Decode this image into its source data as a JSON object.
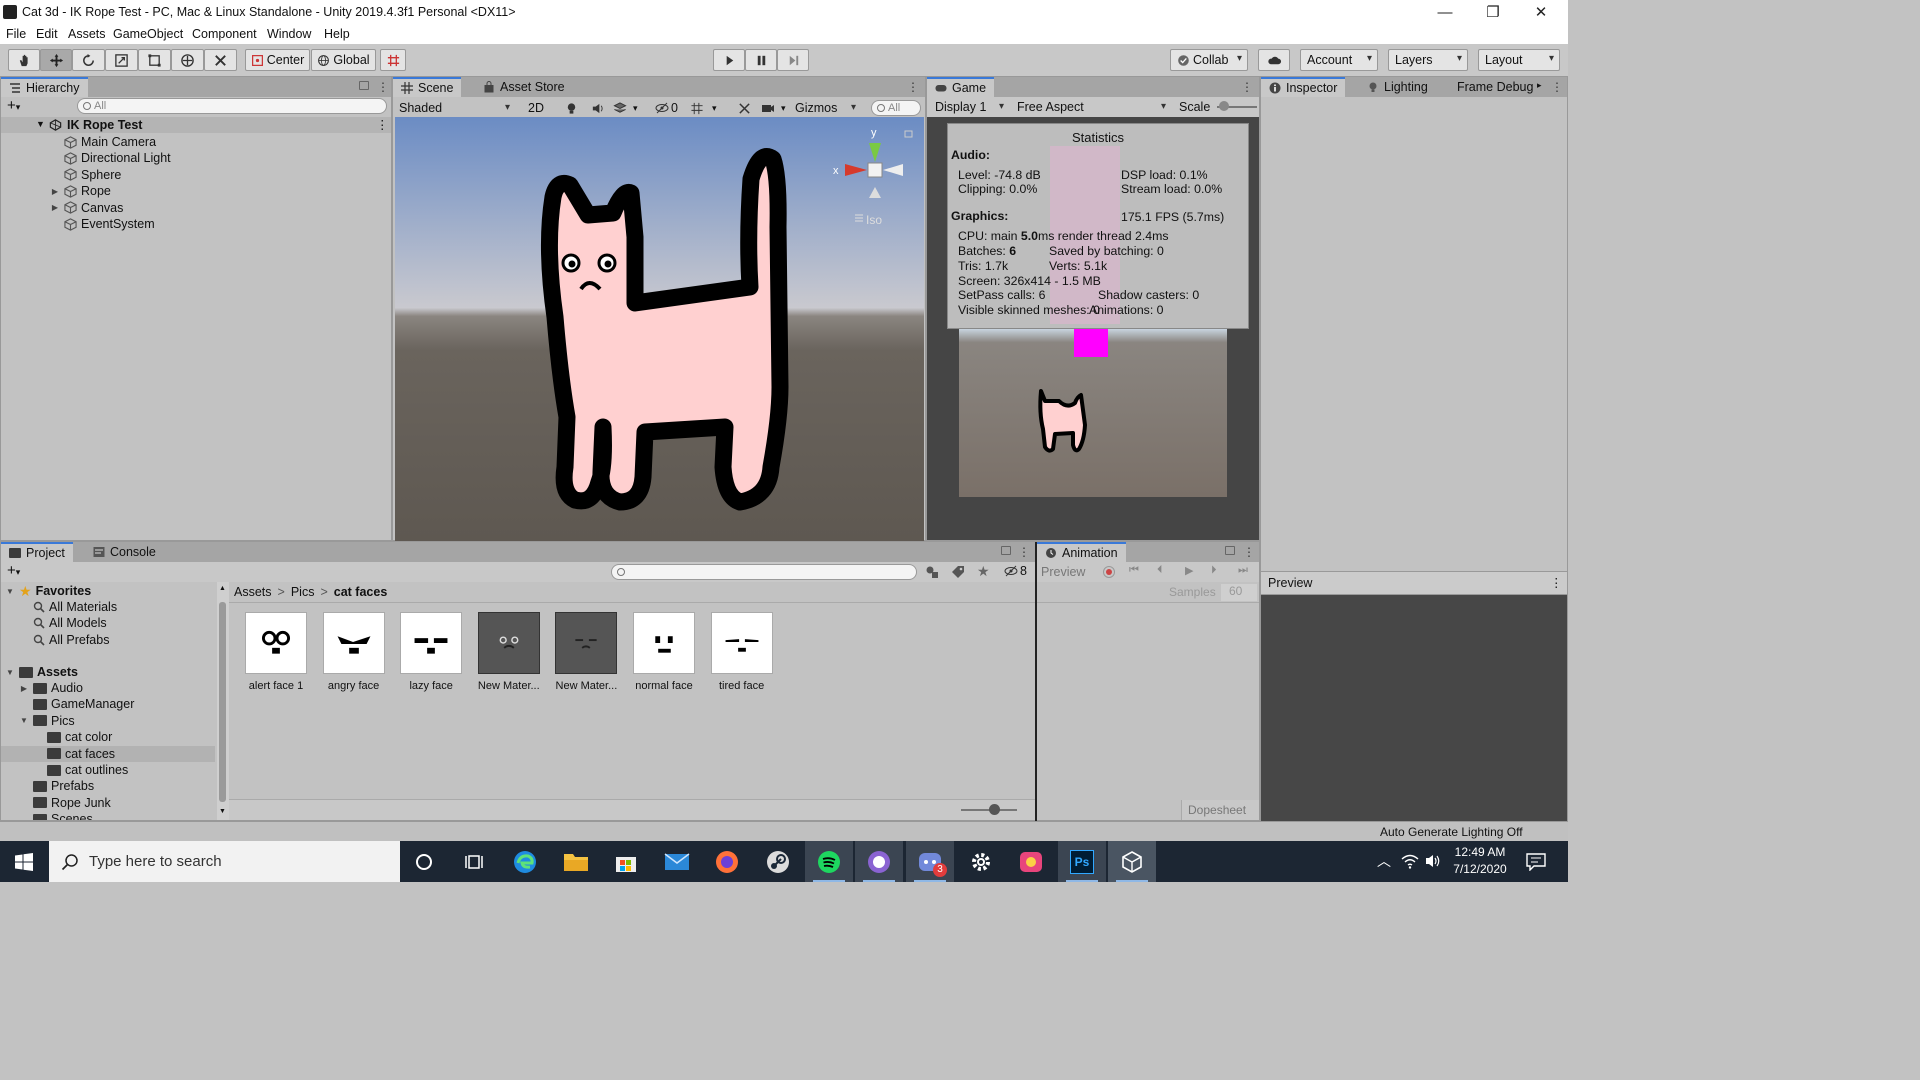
{
  "window": {
    "title": "Cat 3d - IK Rope Test - PC, Mac & Linux Standalone - Unity 2019.4.3f1 Personal <DX11>",
    "minimize_glyph": "—",
    "restore_glyph": "❐",
    "close_glyph": "✕"
  },
  "menu": [
    "File",
    "Edit",
    "Assets",
    "GameObject",
    "Component",
    "Window",
    "Help"
  ],
  "toolbar": {
    "pivot_label": "Center",
    "space_label": "Global",
    "collab_label": "Collab",
    "account_label": "Account",
    "layers_label": "Layers",
    "layout_label": "Layout"
  },
  "hierarchy": {
    "tab_label": "Hierarchy",
    "search_placeholder": "All",
    "add_label": "+",
    "scene_name": "IK Rope Test",
    "items": [
      {
        "label": "Main Camera",
        "foldable": false
      },
      {
        "label": "Directional Light",
        "foldable": false
      },
      {
        "label": "Sphere",
        "foldable": false
      },
      {
        "label": "Rope",
        "foldable": true
      },
      {
        "label": "Canvas",
        "foldable": true
      },
      {
        "label": "EventSystem",
        "foldable": false
      }
    ]
  },
  "scene": {
    "tab_label": "Scene",
    "asset_store_label": "Asset Store",
    "shading_mode": "Shaded",
    "mode_2d": "2D",
    "hidden_count": "0",
    "gizmos_label": "Gizmos",
    "search_placeholder": "All",
    "gizmo_y": "y",
    "gizmo_x": "x",
    "iso_label": "Iso"
  },
  "game": {
    "tab_label": "Game",
    "display_label": "Display 1",
    "aspect_label": "Free Aspect",
    "scale_label": "Scale",
    "stats": {
      "title": "Statistics",
      "audio_header": "Audio:",
      "level": "Level: -74.8 dB",
      "clipping": "Clipping: 0.0%",
      "dsp_load": "DSP load: 0.1%",
      "stream_load": "Stream load: 0.0%",
      "graphics_header": "Graphics:",
      "fps": "175.1 FPS (5.7ms)",
      "cpu_prefix": "CPU: main ",
      "cpu_main": "5.0",
      "cpu_suffix": "ms  render thread 2.4ms",
      "batches_prefix": "Batches: ",
      "batches": "6",
      "saved_batching": "Saved by batching: 0",
      "tris": "Tris: 1.7k",
      "verts": "Verts: 5.1k",
      "screen": "Screen: 326x414 - 1.5 MB",
      "setpass": "SetPass calls: 6",
      "shadow_casters": "Shadow casters: 0",
      "skinned": "Visible skinned meshes: 0",
      "animations": "Animations: 0"
    }
  },
  "inspector": {
    "tab_label": "Inspector",
    "lighting_label": "Lighting",
    "frame_debugger_label": "Frame Debug",
    "preview_label": "Preview"
  },
  "project": {
    "tab_label": "Project",
    "console_label": "Console",
    "hidden_count": "8",
    "favorites_label": "Favorites",
    "favorites": [
      "All Materials",
      "All Models",
      "All Prefabs"
    ],
    "assets_label": "Assets",
    "tree": [
      {
        "label": "Audio",
        "indent": 1,
        "foldable": true
      },
      {
        "label": "GameManager",
        "indent": 1,
        "foldable": false
      },
      {
        "label": "Pics",
        "indent": 1,
        "foldable": true,
        "open": true
      },
      {
        "label": "cat color",
        "indent": 2,
        "foldable": false
      },
      {
        "label": "cat faces",
        "indent": 2,
        "foldable": false,
        "selected": true
      },
      {
        "label": "cat outlines",
        "indent": 2,
        "foldable": false
      },
      {
        "label": "Prefabs",
        "indent": 1,
        "foldable": false
      },
      {
        "label": "Rope Junk",
        "indent": 1,
        "foldable": false
      },
      {
        "label": "Scenes",
        "indent": 1,
        "foldable": false
      }
    ],
    "breadcrumb": [
      "Assets",
      "Pics",
      "cat faces"
    ],
    "breadcrumb_sep": ">",
    "assets": [
      {
        "label": "alert face 1",
        "dark": false
      },
      {
        "label": "angry face",
        "dark": false
      },
      {
        "label": "lazy face",
        "dark": false
      },
      {
        "label": "New Mater...",
        "dark": true
      },
      {
        "label": "New Mater...",
        "dark": true
      },
      {
        "label": "normal face",
        "dark": false
      },
      {
        "label": "tired face",
        "dark": false
      }
    ]
  },
  "animation": {
    "tab_label": "Animation",
    "preview_label": "Preview",
    "samples_label": "Samples",
    "samples_value": "60",
    "dopesheet_label": "Dopesheet"
  },
  "status_bar": {
    "text": "Auto Generate Lighting Off"
  },
  "taskbar": {
    "search_placeholder": "Type here to search",
    "time": "12:49 AM",
    "date": "7/12/2020",
    "discord_badge": "3",
    "ps_label": "Ps"
  },
  "colors": {
    "cat_body": "#ffd0d0",
    "cat_outline": "#000000",
    "sky_top": "#6b8cc4",
    "ground": "#625c55",
    "magenta_object": "#ff00ff",
    "tab_accent": "#3a79d8"
  }
}
